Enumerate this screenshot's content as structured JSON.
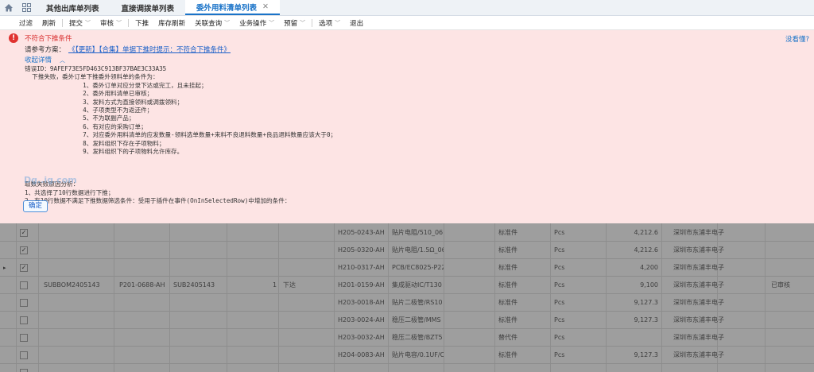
{
  "tabs": [
    {
      "label": "其他出库单列表",
      "active": false
    },
    {
      "label": "直接调拨单列表",
      "active": false
    },
    {
      "label": "委外用料清单列表",
      "active": true,
      "close": "✕"
    }
  ],
  "toolbar": {
    "items": [
      {
        "label": "过滤"
      },
      {
        "label": "刷新"
      },
      {
        "sep": true
      },
      {
        "label": "提交",
        "caret": "﹀"
      },
      {
        "label": "审核",
        "caret": "﹀"
      },
      {
        "sep": true
      },
      {
        "label": "下推"
      },
      {
        "label": "库存刷新"
      },
      {
        "label": "关联查询",
        "caret": "﹀"
      },
      {
        "label": "业务操作",
        "caret": "﹀"
      },
      {
        "label": "预留",
        "caret": "﹀"
      },
      {
        "sep": true
      },
      {
        "label": "选项",
        "caret": "﹀"
      },
      {
        "label": "退出"
      }
    ]
  },
  "dialog": {
    "icon": "!",
    "title": "不符合下推条件",
    "help_link": "没看懂?",
    "ref_label": "请参考方案：",
    "ref_link": "《【更新】【合集】单据下推时提示：不符合下推条件》",
    "collapse_label": "收起详情",
    "collapse_icon": "︿",
    "detail_lines": [
      "错误ID：9AFEF73E5FD463C913BF37BAE3C33A35",
      "  下推失败，委外订单下推委外领料单的条件为：",
      "                1、委外订单对应分录下达或完工，且未挂起；",
      "                2、委外用料清单已审核；",
      "                3、发料方式为直接领料或调拨领料；",
      "                4、子项类型不为返还件；",
      "                5、不为联副产品；",
      "                6、有对应的采购订单；",
      "                7、对应委外用料清单的应发数量-领料选单数量+来料不良退料数量+良品退料数量应该大于0；",
      "                8、发料组织下存在子项物料；",
      "                9、发料组织下的子项物料允许库存。",
      "",
      "",
      "",
      "取数失败原因分析：",
      "1、共选择了10行数据进行下推；",
      "2、有10行数据不满足下推数据筛选条件：受用于插件在事件(OnInSelectedRow)中增加的条件："
    ],
    "ok_label": "确定",
    "watermark": "Dg..ig.com"
  },
  "grid": {
    "rows": [
      {
        "checked": true,
        "no": "",
        "mat": "",
        "plan": "",
        "qty": "",
        "status": "",
        "code": "H205-0243-AH",
        "name": "贴片电阻/510_06",
        "type": "标准件",
        "unit": "Pcs",
        "amount": "4,212.6",
        "supplier": "深圳市东浦丰电子",
        "audit": ""
      },
      {
        "checked": true,
        "no": "",
        "mat": "",
        "plan": "",
        "qty": "",
        "status": "",
        "code": "H205-0320-AH",
        "name": "贴片电阻/1.5Ω_06",
        "type": "标准件",
        "unit": "Pcs",
        "amount": "4,212.6",
        "supplier": "深圳市东浦丰电子",
        "audit": ""
      },
      {
        "checked": true,
        "no": "",
        "mat": "",
        "plan": "",
        "qty": "",
        "status": "",
        "code": "H210-0317-AH",
        "name": "PCB/EC8025-P22",
        "type": "标准件",
        "unit": "Pcs",
        "amount": "4,200",
        "supplier": "深圳市东浦丰电子",
        "audit": "",
        "marker": "▸"
      },
      {
        "checked": false,
        "no": "SUBBOM2405143",
        "mat": "P201-0688-AH",
        "plan": "SUB2405143",
        "qty": "1",
        "status": "下达",
        "code": "H201-0159-AH",
        "name": "集成驱动IC/T130",
        "type": "标准件",
        "unit": "Pcs",
        "amount": "9,100",
        "supplier": "深圳市东浦丰电子",
        "audit": "已审核"
      },
      {
        "checked": false,
        "no": "",
        "mat": "",
        "plan": "",
        "qty": "",
        "status": "",
        "code": "H203-0018-AH",
        "name": "贴片二极管/RS10",
        "type": "标准件",
        "unit": "Pcs",
        "amount": "9,127.3",
        "supplier": "深圳市东浦丰电子",
        "audit": ""
      },
      {
        "checked": false,
        "no": "",
        "mat": "",
        "plan": "",
        "qty": "",
        "status": "",
        "code": "H203-0024-AH",
        "name": "稳压二极管/MMS",
        "type": "标准件",
        "unit": "Pcs",
        "amount": "9,127.3",
        "supplier": "深圳市东浦丰电子",
        "audit": ""
      },
      {
        "checked": false,
        "no": "",
        "mat": "",
        "plan": "",
        "qty": "",
        "status": "",
        "code": "H203-0032-AH",
        "name": "稳压二极管/BZT5",
        "type": "替代件",
        "unit": "Pcs",
        "amount": "",
        "supplier": "深圳市东浦丰电子",
        "audit": ""
      },
      {
        "checked": false,
        "no": "",
        "mat": "",
        "plan": "",
        "qty": "",
        "status": "",
        "code": "H204-0083-AH",
        "name": "贴片电容/0.1UF/C",
        "type": "标准件",
        "unit": "Pcs",
        "amount": "9,127.3",
        "supplier": "深圳市东浦丰电子",
        "audit": ""
      },
      {
        "checked": false,
        "no": "",
        "mat": "",
        "plan": "",
        "qty": "",
        "status": "",
        "code": "",
        "name": "",
        "type": "",
        "unit": "",
        "amount": "",
        "supplier": "",
        "audit": ""
      }
    ]
  },
  "colors": {
    "accent": "#1a73c8",
    "error": "#e0322f",
    "panel_bg": "#fde4e4"
  }
}
